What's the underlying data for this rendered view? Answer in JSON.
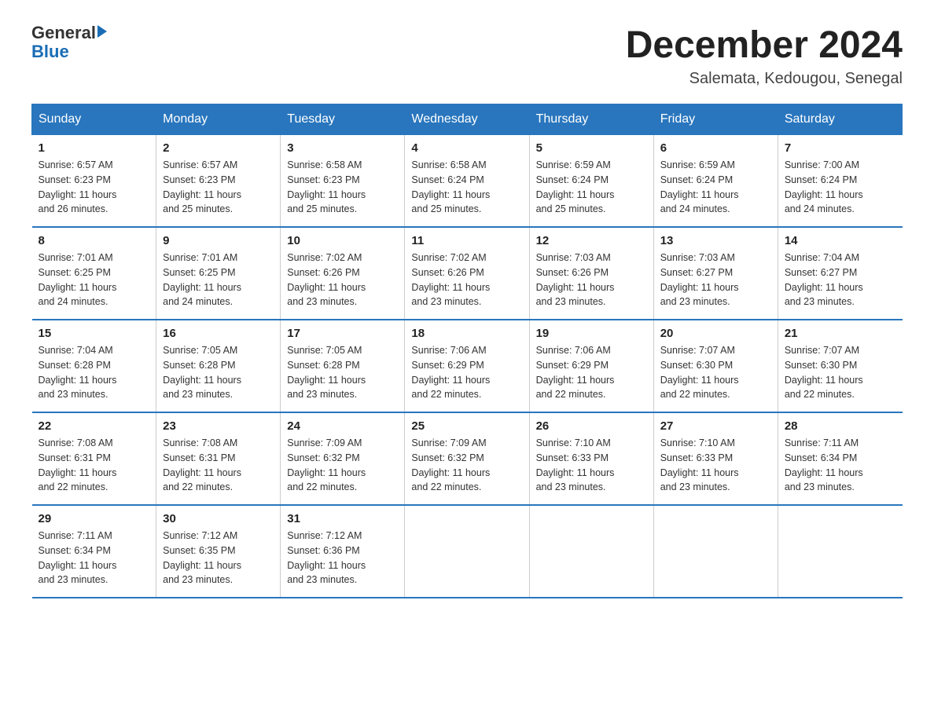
{
  "header": {
    "logo_general": "General",
    "logo_blue": "Blue",
    "month": "December 2024",
    "location": "Salemata, Kedougou, Senegal"
  },
  "days_of_week": [
    "Sunday",
    "Monday",
    "Tuesday",
    "Wednesday",
    "Thursday",
    "Friday",
    "Saturday"
  ],
  "weeks": [
    [
      {
        "day": "1",
        "sunrise": "6:57 AM",
        "sunset": "6:23 PM",
        "daylight": "11 hours and 26 minutes."
      },
      {
        "day": "2",
        "sunrise": "6:57 AM",
        "sunset": "6:23 PM",
        "daylight": "11 hours and 25 minutes."
      },
      {
        "day": "3",
        "sunrise": "6:58 AM",
        "sunset": "6:23 PM",
        "daylight": "11 hours and 25 minutes."
      },
      {
        "day": "4",
        "sunrise": "6:58 AM",
        "sunset": "6:24 PM",
        "daylight": "11 hours and 25 minutes."
      },
      {
        "day": "5",
        "sunrise": "6:59 AM",
        "sunset": "6:24 PM",
        "daylight": "11 hours and 25 minutes."
      },
      {
        "day": "6",
        "sunrise": "6:59 AM",
        "sunset": "6:24 PM",
        "daylight": "11 hours and 24 minutes."
      },
      {
        "day": "7",
        "sunrise": "7:00 AM",
        "sunset": "6:24 PM",
        "daylight": "11 hours and 24 minutes."
      }
    ],
    [
      {
        "day": "8",
        "sunrise": "7:01 AM",
        "sunset": "6:25 PM",
        "daylight": "11 hours and 24 minutes."
      },
      {
        "day": "9",
        "sunrise": "7:01 AM",
        "sunset": "6:25 PM",
        "daylight": "11 hours and 24 minutes."
      },
      {
        "day": "10",
        "sunrise": "7:02 AM",
        "sunset": "6:26 PM",
        "daylight": "11 hours and 23 minutes."
      },
      {
        "day": "11",
        "sunrise": "7:02 AM",
        "sunset": "6:26 PM",
        "daylight": "11 hours and 23 minutes."
      },
      {
        "day": "12",
        "sunrise": "7:03 AM",
        "sunset": "6:26 PM",
        "daylight": "11 hours and 23 minutes."
      },
      {
        "day": "13",
        "sunrise": "7:03 AM",
        "sunset": "6:27 PM",
        "daylight": "11 hours and 23 minutes."
      },
      {
        "day": "14",
        "sunrise": "7:04 AM",
        "sunset": "6:27 PM",
        "daylight": "11 hours and 23 minutes."
      }
    ],
    [
      {
        "day": "15",
        "sunrise": "7:04 AM",
        "sunset": "6:28 PM",
        "daylight": "11 hours and 23 minutes."
      },
      {
        "day": "16",
        "sunrise": "7:05 AM",
        "sunset": "6:28 PM",
        "daylight": "11 hours and 23 minutes."
      },
      {
        "day": "17",
        "sunrise": "7:05 AM",
        "sunset": "6:28 PM",
        "daylight": "11 hours and 23 minutes."
      },
      {
        "day": "18",
        "sunrise": "7:06 AM",
        "sunset": "6:29 PM",
        "daylight": "11 hours and 22 minutes."
      },
      {
        "day": "19",
        "sunrise": "7:06 AM",
        "sunset": "6:29 PM",
        "daylight": "11 hours and 22 minutes."
      },
      {
        "day": "20",
        "sunrise": "7:07 AM",
        "sunset": "6:30 PM",
        "daylight": "11 hours and 22 minutes."
      },
      {
        "day": "21",
        "sunrise": "7:07 AM",
        "sunset": "6:30 PM",
        "daylight": "11 hours and 22 minutes."
      }
    ],
    [
      {
        "day": "22",
        "sunrise": "7:08 AM",
        "sunset": "6:31 PM",
        "daylight": "11 hours and 22 minutes."
      },
      {
        "day": "23",
        "sunrise": "7:08 AM",
        "sunset": "6:31 PM",
        "daylight": "11 hours and 22 minutes."
      },
      {
        "day": "24",
        "sunrise": "7:09 AM",
        "sunset": "6:32 PM",
        "daylight": "11 hours and 22 minutes."
      },
      {
        "day": "25",
        "sunrise": "7:09 AM",
        "sunset": "6:32 PM",
        "daylight": "11 hours and 22 minutes."
      },
      {
        "day": "26",
        "sunrise": "7:10 AM",
        "sunset": "6:33 PM",
        "daylight": "11 hours and 23 minutes."
      },
      {
        "day": "27",
        "sunrise": "7:10 AM",
        "sunset": "6:33 PM",
        "daylight": "11 hours and 23 minutes."
      },
      {
        "day": "28",
        "sunrise": "7:11 AM",
        "sunset": "6:34 PM",
        "daylight": "11 hours and 23 minutes."
      }
    ],
    [
      {
        "day": "29",
        "sunrise": "7:11 AM",
        "sunset": "6:34 PM",
        "daylight": "11 hours and 23 minutes."
      },
      {
        "day": "30",
        "sunrise": "7:12 AM",
        "sunset": "6:35 PM",
        "daylight": "11 hours and 23 minutes."
      },
      {
        "day": "31",
        "sunrise": "7:12 AM",
        "sunset": "6:36 PM",
        "daylight": "11 hours and 23 minutes."
      },
      null,
      null,
      null,
      null
    ]
  ],
  "labels": {
    "sunrise": "Sunrise:",
    "sunset": "Sunset:",
    "daylight": "Daylight:"
  }
}
